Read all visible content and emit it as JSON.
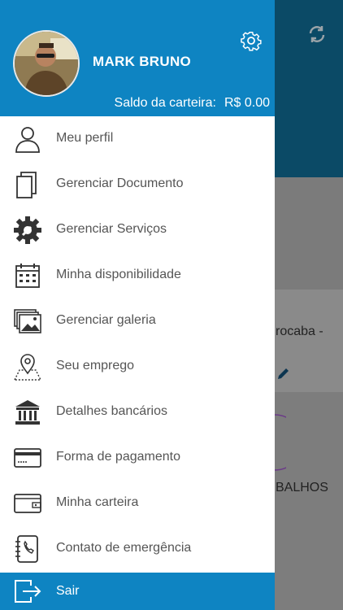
{
  "drawer": {
    "user_name": "MARK BRUNO",
    "wallet_label": "Saldo da carteira:",
    "wallet_value": "R$ 0.00",
    "items": [
      {
        "label": "Meu perfil",
        "icon": "user-icon"
      },
      {
        "label": "Gerenciar Documento",
        "icon": "documents-icon"
      },
      {
        "label": "Gerenciar Serviços",
        "icon": "wrench-gear-icon"
      },
      {
        "label": "Minha disponibilidade",
        "icon": "calendar-icon"
      },
      {
        "label": "Gerenciar galeria",
        "icon": "gallery-icon"
      },
      {
        "label": "Seu emprego",
        "icon": "map-pin-icon"
      },
      {
        "label": "Detalhes bancários",
        "icon": "bank-icon"
      },
      {
        "label": "Forma de pagamento",
        "icon": "credit-card-icon"
      },
      {
        "label": "Minha carteira",
        "icon": "wallet-icon"
      },
      {
        "label": "Contato de emergência",
        "icon": "contact-book-icon"
      }
    ],
    "logout_label": "Sair"
  },
  "background": {
    "location_fragment": "rocaba -",
    "jobs_fragment": "BALHOS"
  },
  "colors": {
    "primary": "#0e84c2",
    "background_top": "#0b4a66"
  }
}
